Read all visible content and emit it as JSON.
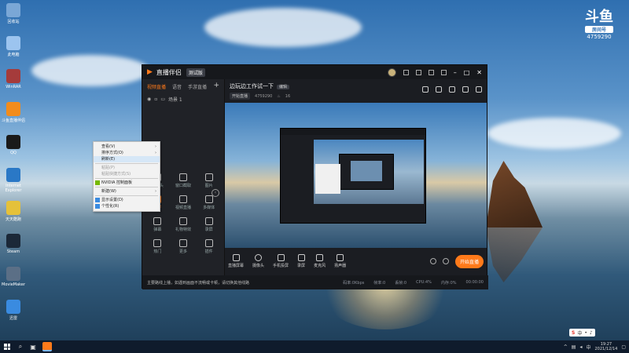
{
  "desktop": {
    "icons": [
      {
        "name": "recycle-bin",
        "label": "回收站"
      },
      {
        "name": "computer",
        "label": "此电脑"
      },
      {
        "name": "winrar",
        "label": "WinRAR"
      },
      {
        "name": "live-companion",
        "label": "斗鱼直播伴侣"
      },
      {
        "name": "qq",
        "label": "QQ"
      },
      {
        "name": "internet-explorer",
        "label": "Internet Explorer"
      },
      {
        "name": "app-yellow",
        "label": "天天酷跑"
      },
      {
        "name": "steam",
        "label": "Steam"
      },
      {
        "name": "moviemaker",
        "label": "MovieMaker"
      },
      {
        "name": "app-blue",
        "label": "迅雷"
      }
    ]
  },
  "badge": {
    "logo": "斗鱼",
    "room_label": "房间号",
    "room_number": "4759290"
  },
  "app": {
    "title": "直播伴侣",
    "version": "测试版",
    "tabs": [
      "视频直播",
      "语音",
      "手游直播"
    ],
    "active_tab": "视频直播",
    "scene": "场景 1",
    "tools": [
      {
        "name": "camera-tool",
        "label": "摄像头"
      },
      {
        "name": "window-tool",
        "label": "窗口截取"
      },
      {
        "name": "image-tool",
        "label": "图片"
      },
      {
        "name": "text-tool",
        "label": "文字"
      },
      {
        "name": "video-tool",
        "label": "视频直播"
      },
      {
        "name": "media-tool",
        "label": "多媒体"
      },
      {
        "name": "danmu-tool",
        "label": "弹幕"
      },
      {
        "name": "gift-tool",
        "label": "礼物特效"
      },
      {
        "name": "record-tool",
        "label": "录屏"
      },
      {
        "name": "hot-tool",
        "label": "热门"
      },
      {
        "name": "more-tool",
        "label": "更多"
      },
      {
        "name": "plugin-tool",
        "label": "插件"
      }
    ],
    "stream": {
      "title": "边玩边工作试一下",
      "edit": "编辑",
      "category": "开始直播",
      "room": "4759290",
      "viewers": "16"
    },
    "controls": [
      {
        "name": "screen-share",
        "label": "直播屏幕"
      },
      {
        "name": "camera",
        "label": "摄像头"
      },
      {
        "name": "phone-cast",
        "label": "手机投屏"
      },
      {
        "name": "record",
        "label": "录屏"
      },
      {
        "name": "mic",
        "label": "麦克风"
      },
      {
        "name": "speaker",
        "label": "扬声器"
      }
    ],
    "start_button": "开始直播",
    "status": {
      "notice": "主要路线上播，如遇到画面不流畅或卡顿，请切换其他线路",
      "metrics": [
        "码率:0Kbps",
        "帧率:0",
        "丢帧:0",
        "CPU:4%",
        "内存:0%",
        "00:00:00"
      ]
    }
  },
  "context_menu": {
    "items": [
      {
        "label": "查看(V)",
        "arrow": true
      },
      {
        "label": "排序方式(O)",
        "arrow": true
      },
      {
        "label": "刷新(E)",
        "highlighted": true
      },
      {
        "sep": true
      },
      {
        "label": "粘贴(P)",
        "disabled": true
      },
      {
        "label": "粘贴快捷方式(S)",
        "disabled": true
      },
      {
        "sep": true
      },
      {
        "label": "NVIDIA 控制面板",
        "icon": true
      },
      {
        "sep": true
      },
      {
        "label": "新建(W)",
        "arrow": true
      },
      {
        "sep": true
      },
      {
        "label": "显示设置(D)",
        "icon": true
      },
      {
        "label": "个性化(R)",
        "icon": true
      }
    ]
  },
  "taskbar": {
    "clock_time": "19:27",
    "clock_date": "2021/12/14",
    "ime_label": "中"
  }
}
